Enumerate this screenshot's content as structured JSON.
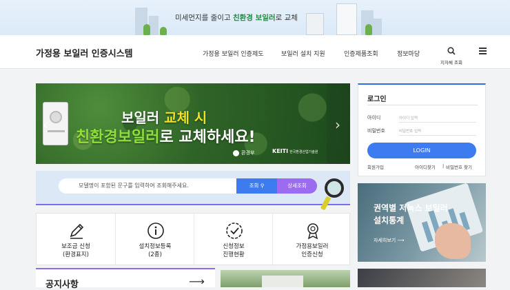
{
  "banner": {
    "text_before": "미세먼지를 줄이고 ",
    "highlight": "친환경 보일러",
    "text_after": "로 교체"
  },
  "header": {
    "logo": "가정용 보일러 인증시스템",
    "nav": [
      "가정용 보일러 인증제도",
      "보일러 설치 지원",
      "인증제품조회",
      "정보마당"
    ],
    "search_label": "지자체 조회"
  },
  "hero": {
    "line1_a": "보일러 ",
    "line1_b": "교체 시",
    "line2_a": "친환경보일러",
    "line2_b": "로 교체하세요!",
    "ministry": "환경부",
    "keiti": "KEITI",
    "keiti_sub": "한국환경산업기술원"
  },
  "login": {
    "title": "로그인",
    "id_label": "아이디",
    "id_placeholder": "아이디 입력",
    "pw_label": "비밀번호",
    "pw_placeholder": "비밀번호 입력",
    "button": "LOGIN",
    "signup": "회원가입",
    "find_id": "아이디찾기",
    "find_pw": "비밀번호 찾기"
  },
  "search": {
    "placeholder": "모델명이 포함된 문구를 입력하여 조회해주세요.",
    "button": "조회",
    "detail_button": "상세조회"
  },
  "quick": [
    {
      "line1": "보조금 신청",
      "line2": "(환경표지)"
    },
    {
      "line1": "설치정보등록",
      "line2": "(2종)"
    },
    {
      "line1": "신청정보",
      "line2": "진행현황"
    },
    {
      "line1": "가정용보일러",
      "line2": "인증신청"
    }
  ],
  "notice": {
    "title": "공지사항"
  },
  "stats": {
    "line1": "권역별 저녹스 보일러",
    "line2": "설치통계",
    "more": "자세히보기"
  },
  "colors": {
    "primary": "#3d7cf0",
    "purple": "#9b6cf0",
    "green": "#1f8a3f"
  }
}
